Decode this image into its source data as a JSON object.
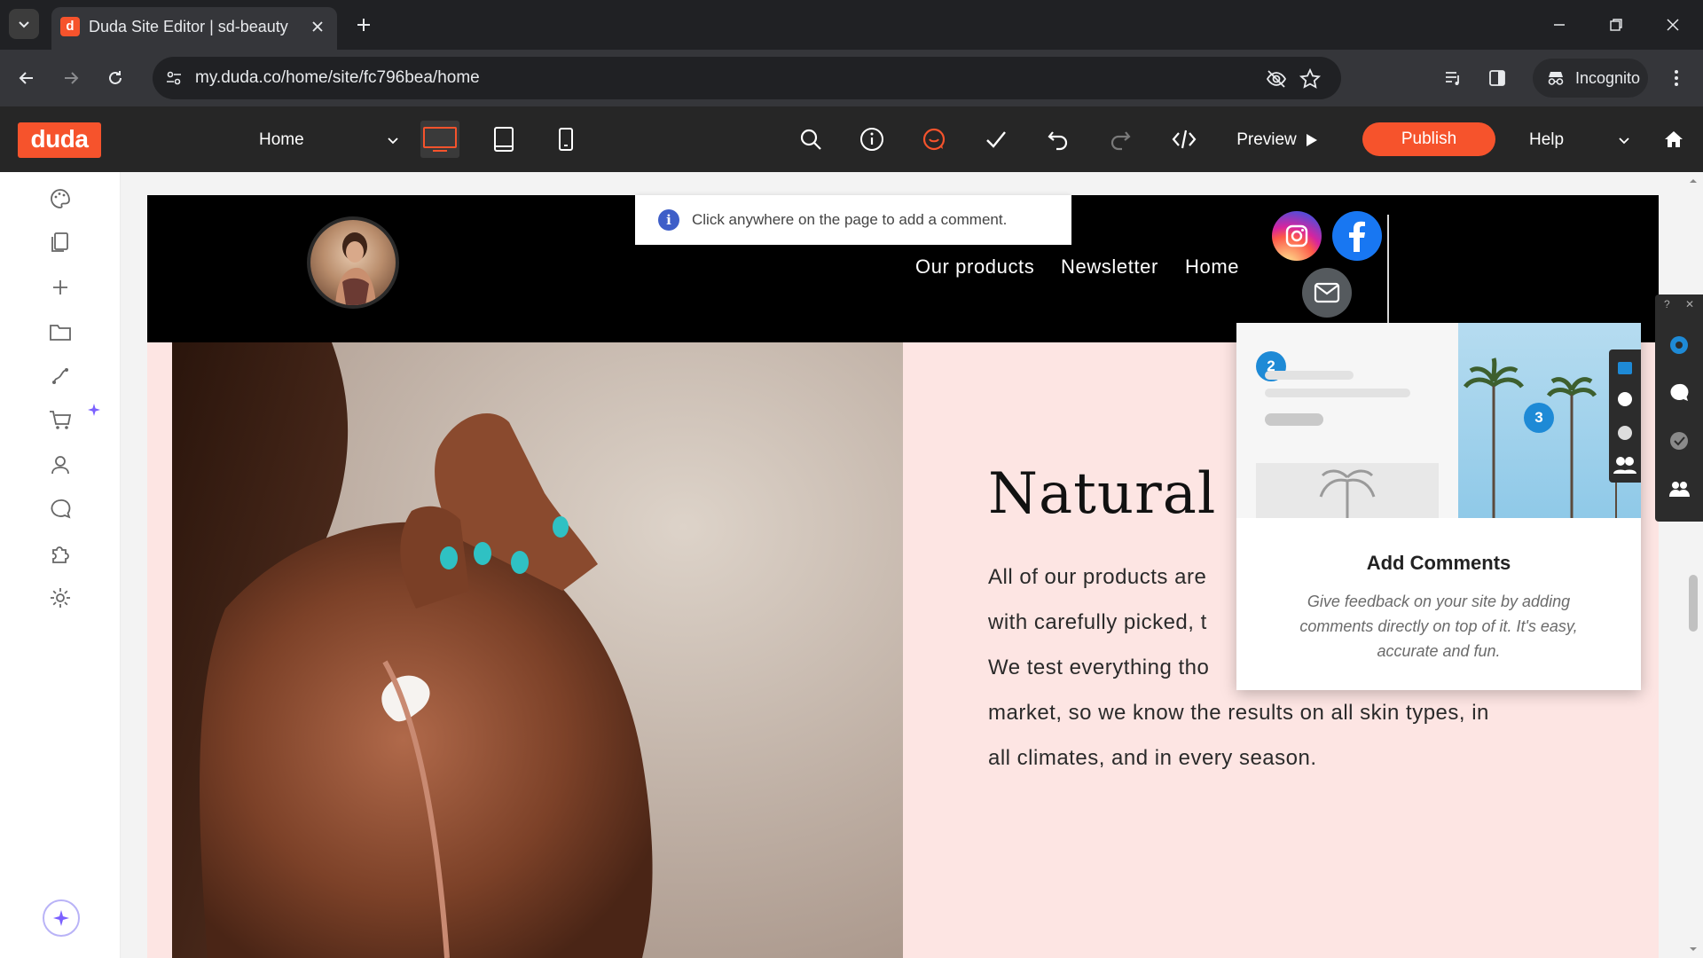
{
  "browser": {
    "tab_title": "Duda Site Editor | sd-beauty",
    "tab_favicon": "d",
    "url": "my.duda.co/home/site/fc796bea/home",
    "incognito_label": "Incognito"
  },
  "editor": {
    "logo": "duda",
    "page_selector": "Home",
    "preview_label": "Preview",
    "publish_label": "Publish",
    "help_label": "Help",
    "accent_color": "#f6532c"
  },
  "site": {
    "comment_hint": "Click anywhere on the page to add a comment.",
    "nav": [
      "Our products",
      "Newsletter",
      "Home"
    ],
    "hero_title": "Natural s",
    "hero_body": [
      "All of our products are",
      "with carefully picked, t",
      "We test everything tho",
      "market, so we know the results on all skin types, in",
      "all climates, and in every season."
    ]
  },
  "comments_popover": {
    "title": "Add Comments",
    "description": "Give feedback on your site by adding comments directly on top of it. It's easy, accurate and fun.",
    "badge_left": "2",
    "badge_right": "3"
  }
}
